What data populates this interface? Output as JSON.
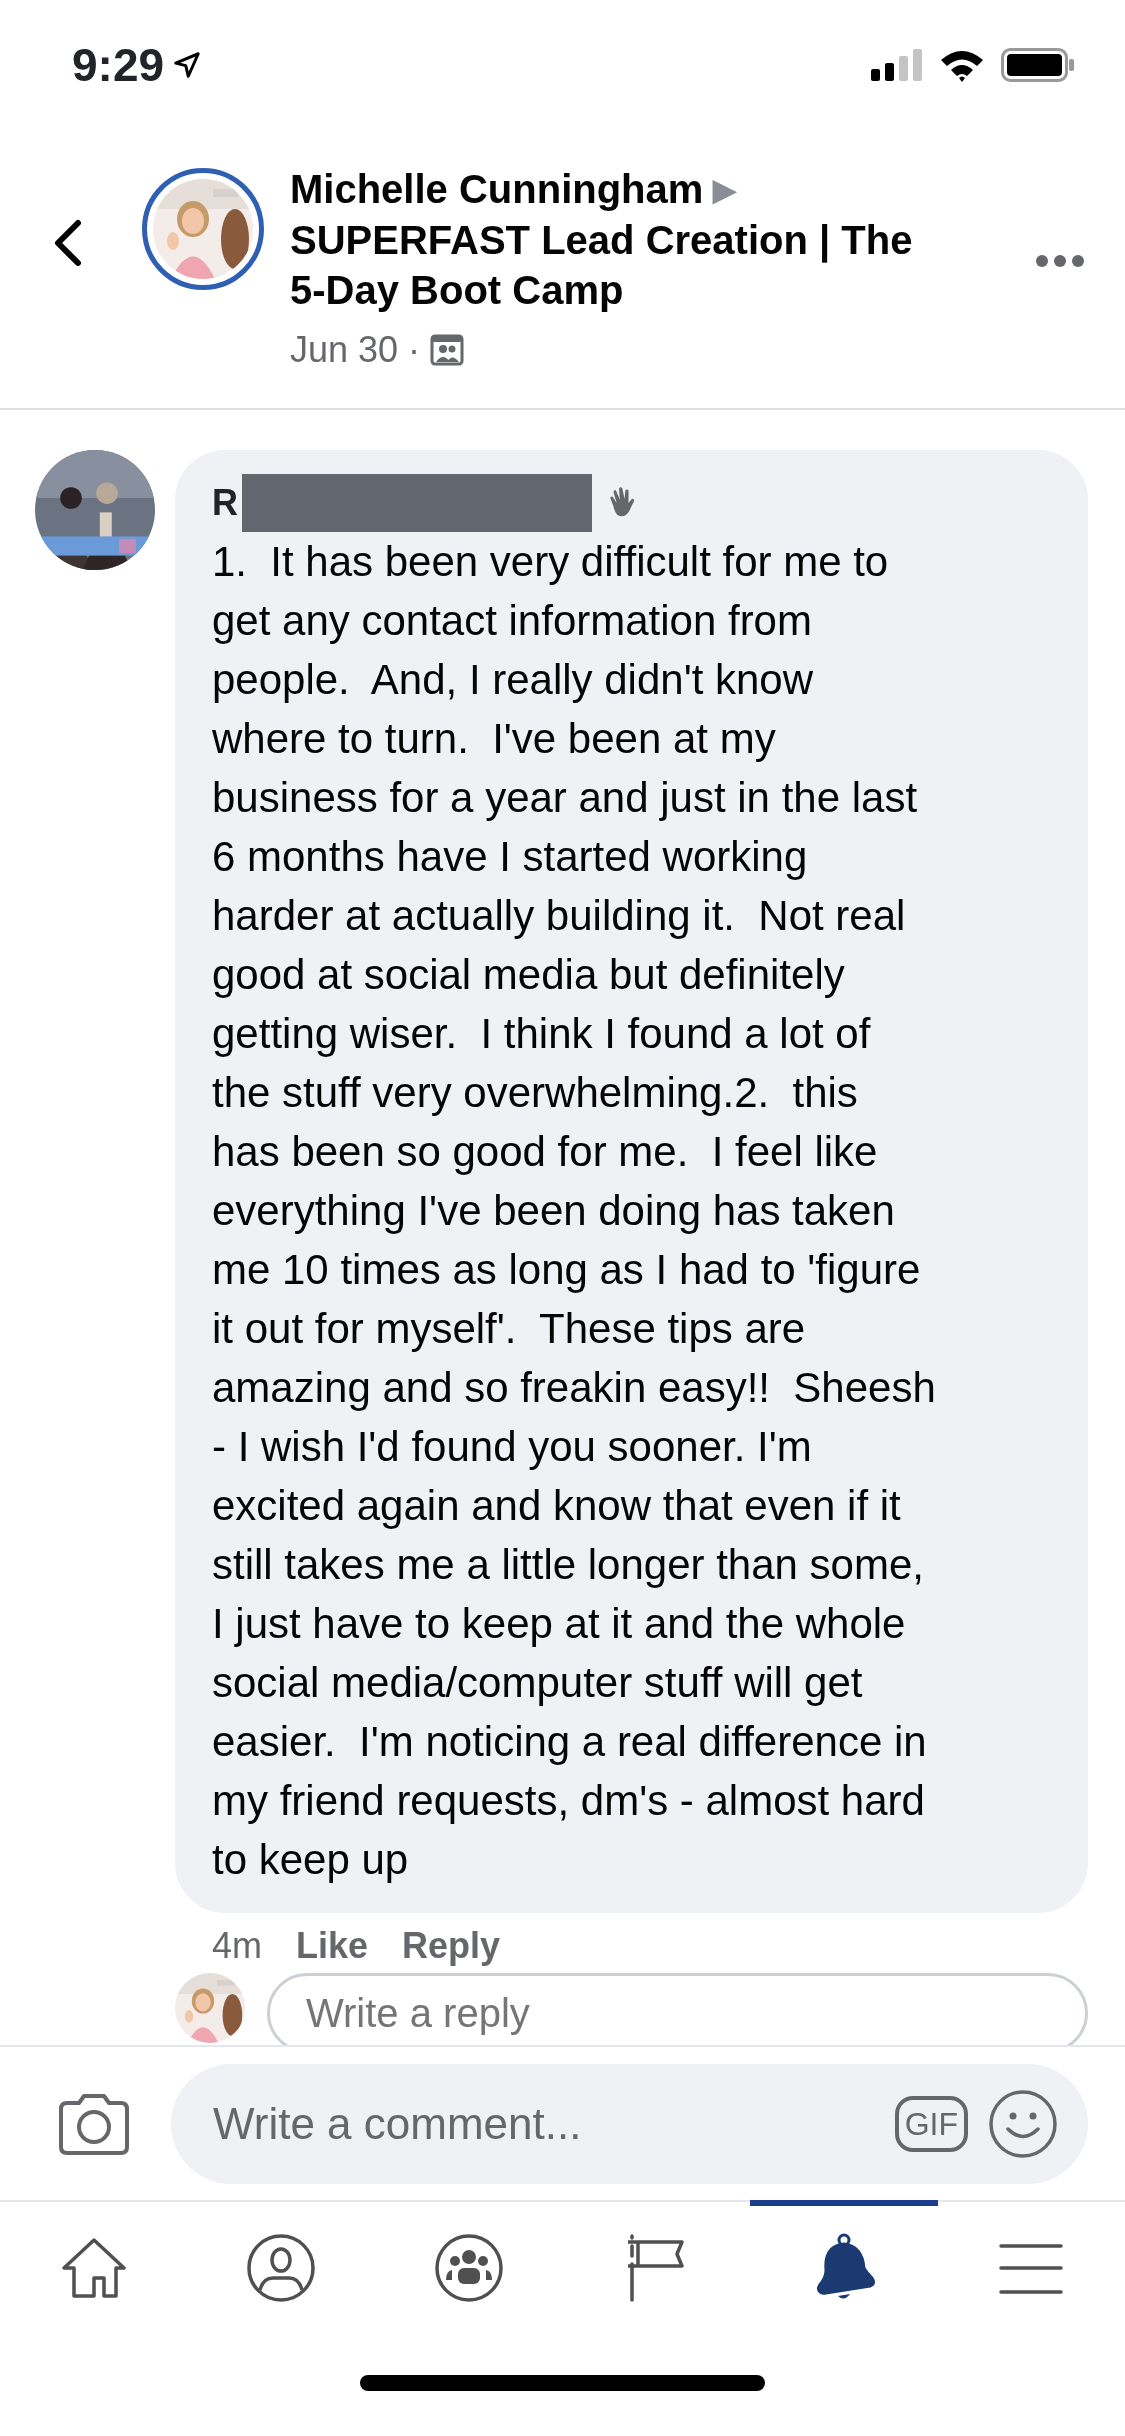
{
  "status_bar": {
    "time": "9:29"
  },
  "header": {
    "author": "Michelle Cunningham",
    "arrow": "▶",
    "group": "SUPERFAST Lead Creation | The 5-Day Boot Camp",
    "date": "Jun 30",
    "separator": "·"
  },
  "comment": {
    "author_initial": "R",
    "author_redacted": true,
    "text": "1.  It has been very difficult for me to\nget any contact information from\npeople.  And, I really didn't know\nwhere to turn.  I've been at my\nbusiness for a year and just in the last\n6 months have I started working\nharder at actually building it.  Not real\ngood at social media but definitely\ngetting wiser.  I think I found a lot of\nthe stuff very overwhelming.2.  this\nhas been so good for me.  I feel like\neverything I've been doing has taken\nme 10 times as long as I had to 'figure\nit out for myself'.  These tips are\namazing and so freakin easy!!  Sheesh\n- I wish I'd found you sooner. I'm\nexcited again and know that even if it\nstill takes me a little longer than some,\nI just have to keep at it and the whole\nsocial media/computer stuff will get\neasier.  I'm noticing a real difference in\nmy friend requests, dm's - almost hard\nto keep up",
    "time": "4m",
    "actions": [
      "Like",
      "Reply"
    ]
  },
  "reply_field": {
    "placeholder": "Write a reply"
  },
  "composer": {
    "placeholder": "Write a comment...",
    "gif": "GIF"
  },
  "tab_bar": [
    {
      "kind": "home",
      "selected": false
    },
    {
      "kind": "profile",
      "selected": false
    },
    {
      "kind": "groups",
      "selected": false
    },
    {
      "kind": "pages",
      "selected": false
    },
    {
      "kind": "notifications",
      "selected": true
    },
    {
      "kind": "menu",
      "selected": false
    }
  ]
}
